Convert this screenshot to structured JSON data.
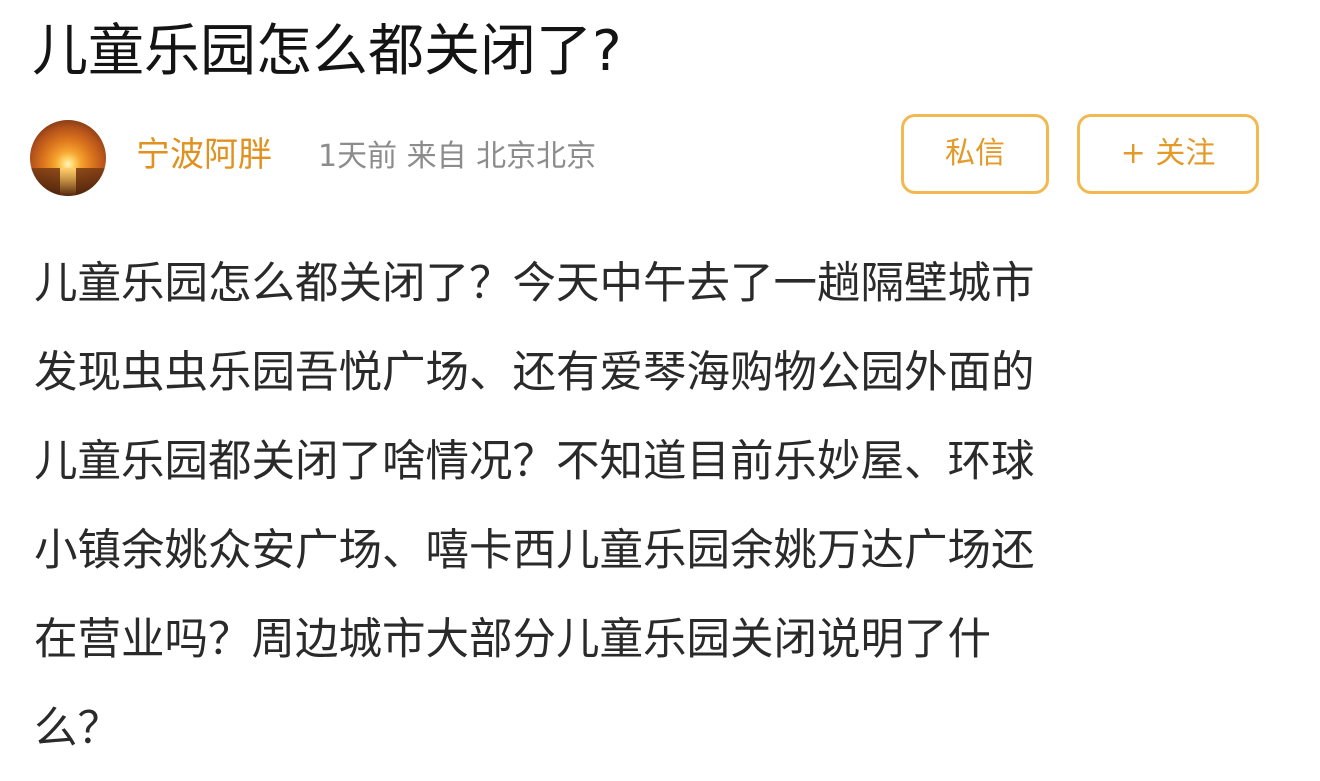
{
  "post": {
    "title": "儿童乐园怎么都关闭了?",
    "author": {
      "name": "宁波阿胖",
      "avatar_icon": "sunset-avatar-icon"
    },
    "meta": "1天前 来自 北京北京",
    "actions": {
      "message_label": "私信",
      "follow_label": "+ 关注"
    },
    "body_lines": [
      "儿童乐园怎么都关闭了？今天中午去了一趟隔壁城市",
      "发现虫虫乐园吾悦广场、还有爱琴海购物公园外面的",
      "儿童乐园都关闭了啥情况？不知道目前乐妙屋、环球",
      "小镇余姚众安广场、嘻卡西儿童乐园余姚万达广场还",
      "在营业吗？周边城市大部分儿童乐园关闭说明了什",
      "么？"
    ]
  },
  "colors": {
    "accent": "#e39a28",
    "button_border": "#f1b94f",
    "author_name": "#e0911f",
    "meta_text": "#8c8c8c",
    "title_text": "#141414",
    "body_text": "#2a2a2a"
  }
}
